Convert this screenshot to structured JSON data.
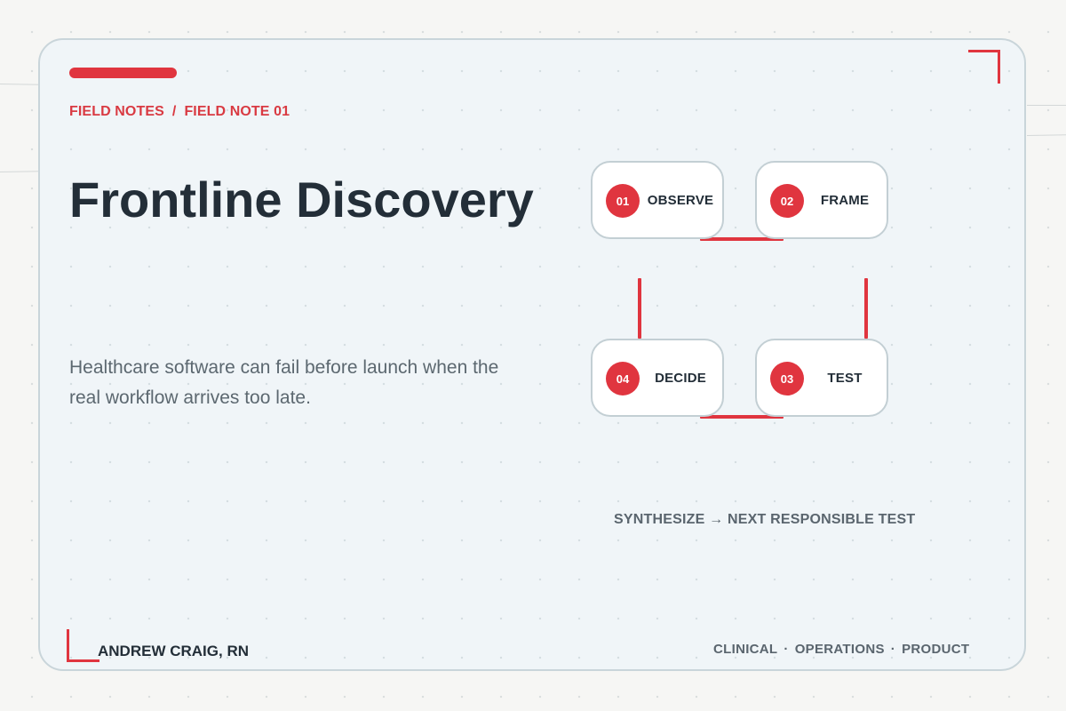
{
  "colors": {
    "accent": "#e0353f",
    "heading": "#232e38",
    "muted": "#5a656e",
    "card_background": "#f0f5f8",
    "page_background": "#f6f6f4"
  },
  "breadcrumb": {
    "section": "FIELD NOTES",
    "separator": "/",
    "current": "FIELD NOTE 01"
  },
  "title": "Frontline Discovery",
  "description": "Healthcare software can fail before launch when the real workflow arrives too late.",
  "steps": [
    {
      "number": "01",
      "label": "OBSERVE"
    },
    {
      "number": "02",
      "label": "FRAME"
    },
    {
      "number": "03",
      "label": "TEST"
    },
    {
      "number": "04",
      "label": "DECIDE"
    }
  ],
  "synthesis": "SYNTHESIZE → NEXT RESPONSIBLE TEST",
  "footer": {
    "author": "ANDREW CRAIG, RN",
    "tags": [
      "CLINICAL",
      "OPERATIONS",
      "PRODUCT"
    ],
    "tag_separator": "·"
  }
}
